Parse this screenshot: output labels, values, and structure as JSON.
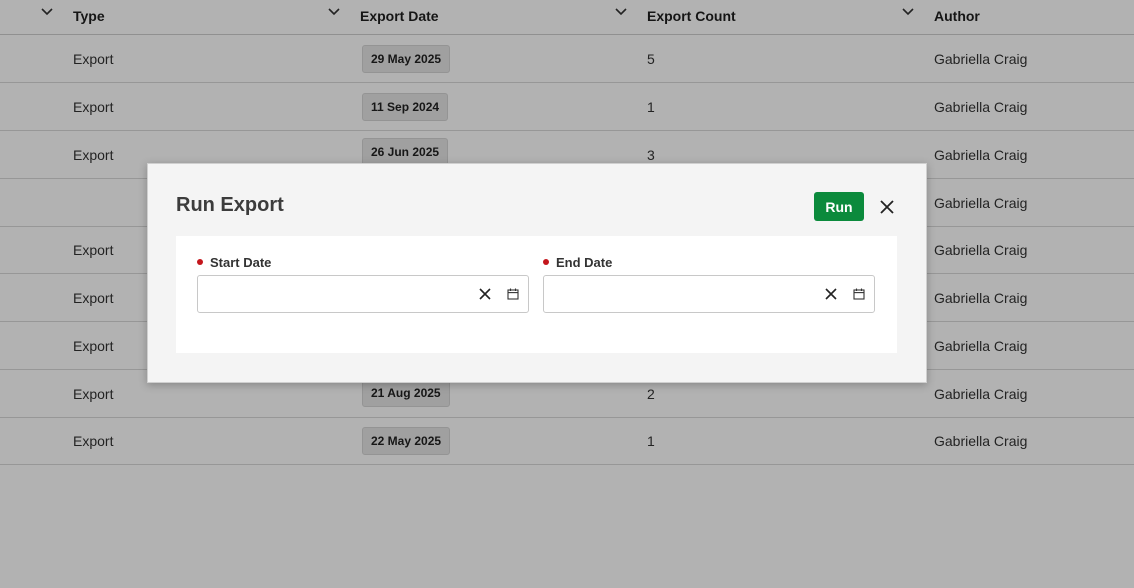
{
  "table": {
    "columns": [
      {
        "label": "Type",
        "chevron_icon": "chevron-down-icon"
      },
      {
        "label": "Export Date",
        "chevron_icon": "chevron-down-icon"
      },
      {
        "label": "Export Count",
        "chevron_icon": "chevron-down-icon"
      },
      {
        "label": "Author",
        "chevron_icon": "chevron-down-icon"
      }
    ],
    "rows": [
      {
        "type": "Export",
        "date": "29 May 2025",
        "count": "5",
        "author": "Gabriella Craig"
      },
      {
        "type": "Export",
        "date": "11 Sep 2024",
        "count": "1",
        "author": "Gabriella Craig"
      },
      {
        "type": "Export",
        "date": "26 Jun 2025",
        "count": "3",
        "author": "Gabriella Craig"
      },
      {
        "type": "",
        "date": "",
        "count": "",
        "author": "Gabriella Craig"
      },
      {
        "type": "Export",
        "date": "",
        "count": "",
        "author": "Gabriella Craig"
      },
      {
        "type": "Export",
        "date": "",
        "count": "",
        "author": "Gabriella Craig"
      },
      {
        "type": "Export",
        "date": "",
        "count": "",
        "author": "Gabriella Craig"
      },
      {
        "type": "Export",
        "date": "21 Aug 2025",
        "count": "2",
        "author": "Gabriella Craig"
      },
      {
        "type": "Export",
        "date": "22 May 2025",
        "count": "1",
        "author": "Gabriella Craig"
      }
    ]
  },
  "modal": {
    "title": "Run Export",
    "run_label": "Run",
    "close_icon": "close-icon",
    "start_date": {
      "label": "Start Date",
      "value": "",
      "placeholder": "",
      "required": true
    },
    "end_date": {
      "label": "End Date",
      "value": "",
      "placeholder": "",
      "required": true
    }
  },
  "colors": {
    "primary_button": "#0b8a3c",
    "required_indicator": "#c4161c",
    "overlay": "rgba(0,0,0,0.30)"
  }
}
